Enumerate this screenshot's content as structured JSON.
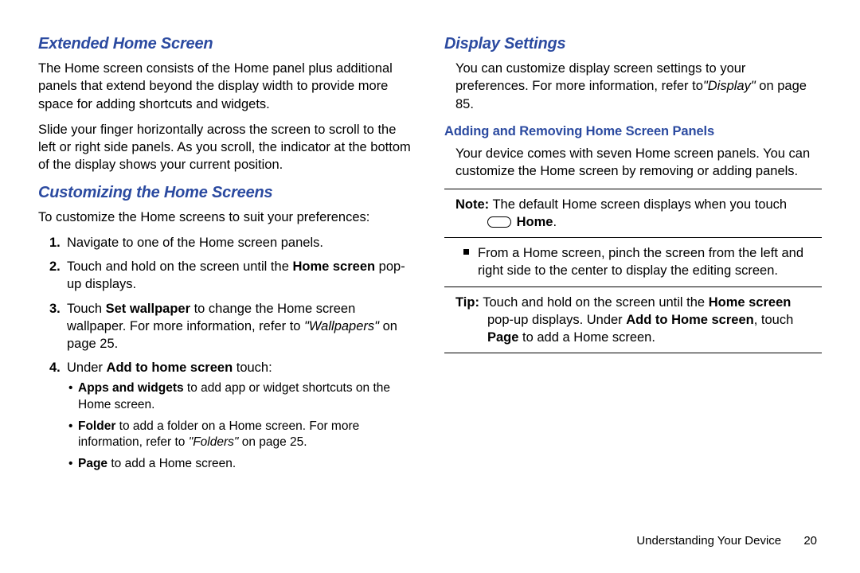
{
  "left": {
    "h_extended": "Extended Home Screen",
    "p_ext1": "The Home screen consists of the Home panel plus additional panels that extend beyond the display width to provide more space for adding shortcuts and widgets.",
    "p_ext2": "Slide your finger horizontally across the screen to scroll to the left or right side panels. As you scroll, the indicator at the bottom of the display shows your current position.",
    "h_custom": "Customizing the Home Screens",
    "p_cust_intro": "To customize the Home screens to suit your preferences:",
    "steps": {
      "s1": "Navigate to one of the Home screen panels.",
      "s2a": "Touch and hold on the screen until the ",
      "s2b_bold": "Home screen",
      "s2c": " pop-up displays.",
      "s3a": "Touch ",
      "s3b_bold": "Set wallpaper",
      "s3c": " to change the Home screen wallpaper. For more information, refer to ",
      "s3d_italic": "\"Wallpapers\"",
      "s3e": " on page 25.",
      "s4a": "Under ",
      "s4b_bold": "Add to home screen",
      "s4c": " touch:"
    },
    "sub": {
      "b1a_bold": "Apps and widgets",
      "b1b": " to add app or widget shortcuts on the Home screen.",
      "b2a_bold": "Folder",
      "b2b": " to add a folder on a Home screen. For more information, refer to ",
      "b2c_italic": "\"Folders\"",
      "b2d": " on page 25.",
      "b3a_bold": "Page",
      "b3b": " to add a Home screen."
    }
  },
  "right": {
    "h_display": "Display Settings",
    "p_disp1a": "You can customize display screen settings to your preferences. For more information, refer to",
    "p_disp1b_italic": "\"Display\"",
    "p_disp1c": " on page 85.",
    "h_add": "Adding and Removing Home Screen Panels",
    "p_add1": "Your device comes with seven Home screen panels. You can customize the Home screen by removing or adding panels.",
    "note": {
      "label": "Note:",
      "text": " The default Home screen displays when you touch ",
      "home_bold": "Home",
      "period": "."
    },
    "pinch": "From a Home screen, pinch the screen from the left and right side to the center to display the editing screen.",
    "tip": {
      "label": "Tip:",
      "t1": " Touch and hold on the screen until the ",
      "t2_bold": "Home screen",
      "t3": " pop-up displays. Under ",
      "t4_bold": "Add to Home screen",
      "t5": ", touch ",
      "t6_bold": "Page",
      "t7": " to add a Home screen."
    }
  },
  "footer": {
    "section": "Understanding Your Device",
    "page": "20"
  }
}
